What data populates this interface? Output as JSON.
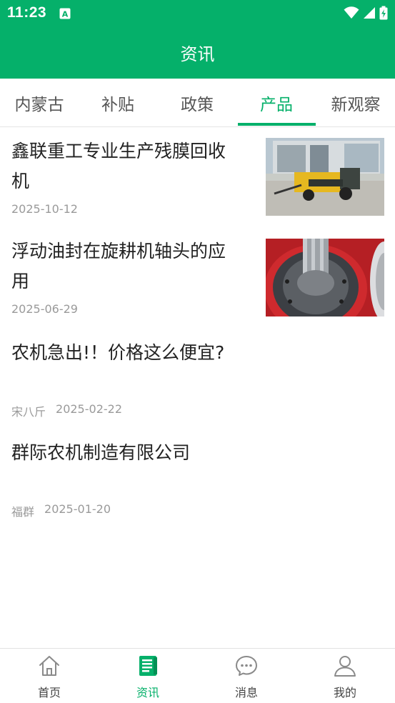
{
  "status_bar": {
    "time": "11:23",
    "icons": [
      "a-notification-icon",
      "wifi-icon",
      "signal-icon",
      "battery-charging-icon"
    ]
  },
  "header": {
    "title": "资讯"
  },
  "tabs": [
    {
      "label": "内蒙古",
      "active": false
    },
    {
      "label": "补贴",
      "active": false
    },
    {
      "label": "政策",
      "active": false
    },
    {
      "label": "产品",
      "active": true
    },
    {
      "label": "新观察",
      "active": false
    }
  ],
  "news": [
    {
      "title_line1": "鑫联重工专业生产残膜回收",
      "title_line2": "机",
      "source": "",
      "date": "2025-10-12",
      "thumbnail": "baler-machine-photo"
    },
    {
      "title_line1": "浮动油封在旋耕机轴头的应",
      "title_line2": "用",
      "source": "",
      "date": "2025-06-29",
      "thumbnail": "oil-seal-photo"
    },
    {
      "title_line1": "农机急出!！价格这么便宜?",
      "source": "宋八斤",
      "date": "2025-02-22"
    },
    {
      "title_line1": "群际农机制造有限公司",
      "source": "福群",
      "date": "2025-01-20"
    }
  ],
  "bottom_nav": [
    {
      "label": "首页",
      "icon": "home-icon",
      "active": false
    },
    {
      "label": "资讯",
      "icon": "news-icon",
      "active": true
    },
    {
      "label": "消息",
      "icon": "message-icon",
      "active": false
    },
    {
      "label": "我的",
      "icon": "profile-icon",
      "active": false
    }
  ],
  "colors": {
    "brand": "#05b06a",
    "meta_text": "#9a9a9a"
  }
}
